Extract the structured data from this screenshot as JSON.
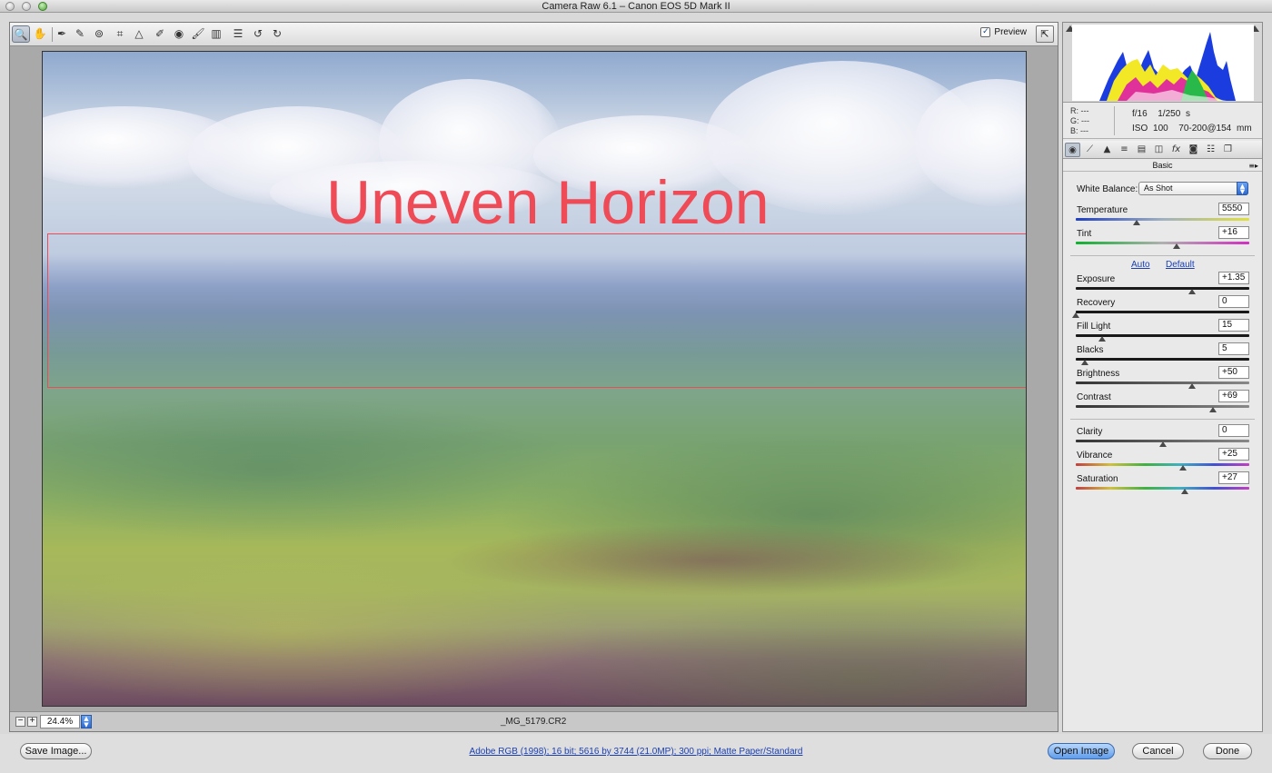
{
  "window": {
    "title": "Camera Raw 6.1  –  Canon EOS 5D Mark II"
  },
  "toolbar": {
    "tools": [
      "zoom-icon",
      "hand-icon",
      "white-balance-icon",
      "color-sampler-icon",
      "targeted-adjustment-icon",
      "crop-icon",
      "straighten-icon",
      "spot-removal-icon",
      "red-eye-icon",
      "adjustment-brush-icon",
      "graduated-filter-icon",
      "preferences-icon",
      "rotate-left-icon",
      "rotate-right-icon"
    ],
    "preview_label": "Preview",
    "preview_checked": true
  },
  "image": {
    "overlay_text": "Uneven Horizon",
    "overlay_color": "#ee4b57",
    "filename": "_MG_5179.CR2"
  },
  "zoom": {
    "value": "24.4%"
  },
  "info": {
    "r_label": "R:",
    "r_value": "---",
    "g_label": "G:",
    "g_value": "---",
    "b_label": "B:",
    "b_value": "---",
    "aperture": "f/16",
    "shutter": "1/250 s",
    "iso": "ISO 100",
    "lens": "70-200@154 mm"
  },
  "panel": {
    "title": "Basic",
    "tabs": [
      "basic-icon",
      "tone-curve-icon",
      "detail-icon",
      "hsl-icon",
      "split-toning-icon",
      "lens-corrections-icon",
      "effects-icon",
      "camera-calibration-icon",
      "presets-icon",
      "snapshots-icon"
    ],
    "white_balance_label": "White Balance:",
    "white_balance_value": "As Shot",
    "auto_label": "Auto",
    "default_label": "Default",
    "sliders": [
      {
        "label": "Temperature",
        "value": "5550",
        "pos": 0.35
      },
      {
        "label": "Tint",
        "value": "+16",
        "pos": 0.58
      },
      {
        "label": "Exposure",
        "value": "+1.35",
        "pos": 0.67
      },
      {
        "label": "Recovery",
        "value": "0",
        "pos": 0.0
      },
      {
        "label": "Fill Light",
        "value": "15",
        "pos": 0.15
      },
      {
        "label": "Blacks",
        "value": "5",
        "pos": 0.05
      },
      {
        "label": "Brightness",
        "value": "+50",
        "pos": 0.67
      },
      {
        "label": "Contrast",
        "value": "+69",
        "pos": 0.79
      },
      {
        "label": "Clarity",
        "value": "0",
        "pos": 0.5
      },
      {
        "label": "Vibrance",
        "value": "+25",
        "pos": 0.62
      },
      {
        "label": "Saturation",
        "value": "+27",
        "pos": 0.63
      }
    ]
  },
  "footer": {
    "save_label": "Save Image...",
    "workflow_text": "Adobe RGB (1998); 16 bit; 5616 by 3744 (21.0MP); 300 ppi; Matte Paper/Standard",
    "open_label": "Open Image",
    "cancel_label": "Cancel",
    "done_label": "Done"
  }
}
